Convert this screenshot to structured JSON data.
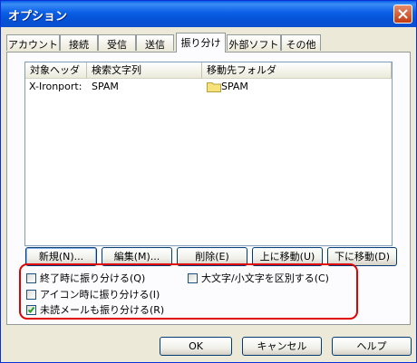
{
  "window": {
    "title": "オプション"
  },
  "tabs": [
    "アカウント",
    "接続",
    "受信",
    "送信",
    "振り分け",
    "外部ソフト",
    "その他"
  ],
  "active_tab": "振り分け",
  "list": {
    "columns": [
      "対象ヘッダ",
      "検索文字列",
      "移動先フォルダ"
    ],
    "rows": [
      {
        "header": "X-Ironport:",
        "search": "SPAM",
        "folder": "SPAM"
      }
    ]
  },
  "buttons": {
    "new": "新規(N)...",
    "edit": "編集(M)...",
    "delete": "削除(E)",
    "move_up": "上に移動(U)",
    "move_down": "下に移動(D)"
  },
  "options": {
    "sort_on_exit": {
      "label": "終了時に振り分ける(Q)",
      "checked": false
    },
    "case_sensitive": {
      "label": "大文字/小文字を区別する(C)",
      "checked": false
    },
    "sort_on_iconize": {
      "label": "アイコン時に振り分ける(I)",
      "checked": false
    },
    "sort_unread": {
      "label": "未読メールも振り分ける(R)",
      "checked": true
    }
  },
  "footer": {
    "ok": "OK",
    "cancel": "キャンセル",
    "help": "ヘルプ"
  },
  "colors": {
    "titlebar": "#0a5fe6",
    "highlight": "#e00000",
    "folder": "#f6e27a"
  },
  "icons": {
    "close": "close-icon",
    "folder": "folder-icon",
    "check": "checkmark-icon"
  }
}
